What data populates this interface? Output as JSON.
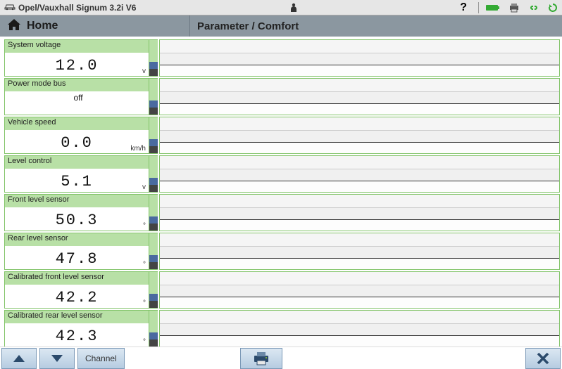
{
  "titlebar": {
    "vehicle": "Opel/Vauxhall Signum 3.2i V6"
  },
  "header": {
    "home": "Home",
    "section": "Parameter / Comfort"
  },
  "params": [
    {
      "label": "System voltage",
      "value": "12.0",
      "unit": "v",
      "big": true
    },
    {
      "label": "Power mode bus",
      "value": "off",
      "unit": "",
      "big": false
    },
    {
      "label": "Vehicle speed",
      "value": "0.0",
      "unit": "km/h",
      "big": true
    },
    {
      "label": "Level control",
      "value": "5.1",
      "unit": "v",
      "big": true
    },
    {
      "label": "Front level sensor",
      "value": "50.3",
      "unit": "°",
      "big": true
    },
    {
      "label": "Rear level sensor",
      "value": "47.8",
      "unit": "°",
      "big": true
    },
    {
      "label": "Calibrated front level sensor",
      "value": "42.2",
      "unit": "°",
      "big": true
    },
    {
      "label": "Calibrated rear level sensor",
      "value": "42.3",
      "unit": "°",
      "big": true
    }
  ],
  "bottom": {
    "channel": "Channel"
  }
}
